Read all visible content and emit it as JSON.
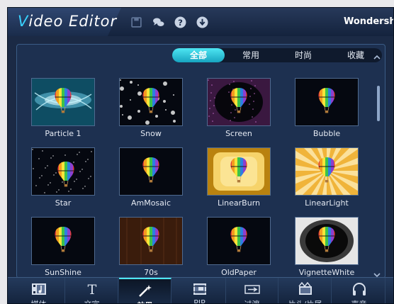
{
  "app": {
    "title_first": "V",
    "title_rest": "ideo Editor",
    "company": "Wondersh"
  },
  "colors": {
    "accent": "#39d2ff",
    "active_tab": "#17a4c0",
    "background": "#1b2a45"
  },
  "toolbar_icons": [
    "save-icon",
    "chat-icon",
    "help-icon",
    "download-icon"
  ],
  "tabs": [
    {
      "label": "全部",
      "active": true
    },
    {
      "label": "常用",
      "active": false
    },
    {
      "label": "时尚",
      "active": false
    },
    {
      "label": "收藏",
      "active": false
    }
  ],
  "effects": [
    {
      "label": "Particle 1",
      "style": "particle"
    },
    {
      "label": "Snow",
      "style": "snow"
    },
    {
      "label": "Screen",
      "style": "screen"
    },
    {
      "label": "Bubble",
      "style": "plain"
    },
    {
      "label": "Star",
      "style": "star"
    },
    {
      "label": "AmMosaic",
      "style": "plain"
    },
    {
      "label": "LinearBurn",
      "style": "burn"
    },
    {
      "label": "LinearLight",
      "style": "light"
    },
    {
      "label": "SunShine",
      "style": "plain"
    },
    {
      "label": "70s",
      "style": "seventies"
    },
    {
      "label": "OldPaper",
      "style": "plain"
    },
    {
      "label": "VignetteWhite",
      "style": "vignette"
    }
  ],
  "bottom_tools": [
    {
      "label": "媒体",
      "icon": "media-icon",
      "active": false
    },
    {
      "label": "文字",
      "icon": "text-icon",
      "active": false
    },
    {
      "label": "效果",
      "icon": "effects-wand-icon",
      "active": true
    },
    {
      "label": "PIP",
      "icon": "pip-film-icon",
      "active": false
    },
    {
      "label": "过渡",
      "icon": "transition-icon",
      "active": false
    },
    {
      "label": "片头/片尾",
      "icon": "intro-credits-icon",
      "active": false
    },
    {
      "label": "声音",
      "icon": "sound-headphones-icon",
      "active": false
    }
  ]
}
